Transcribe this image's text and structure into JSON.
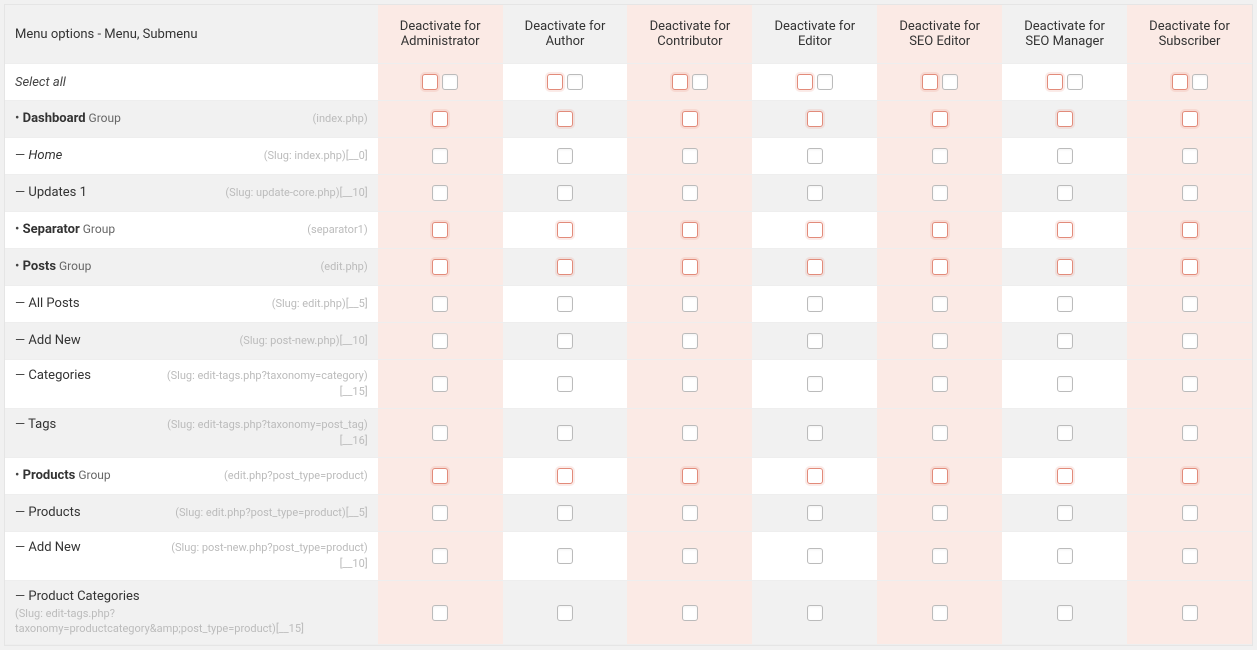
{
  "header": {
    "menu_options": "Menu options - Menu, Submenu"
  },
  "roles": [
    {
      "label": "Deactivate for Administrator",
      "tint": true
    },
    {
      "label": "Deactivate for Author",
      "tint": false
    },
    {
      "label": "Deactivate for Contributor",
      "tint": true
    },
    {
      "label": "Deactivate for Editor",
      "tint": false
    },
    {
      "label": "Deactivate for SEO Editor",
      "tint": true
    },
    {
      "label": "Deactivate for SEO Manager",
      "tint": false
    },
    {
      "label": "Deactivate for Subscriber",
      "tint": true
    }
  ],
  "select_all_label": "Select all",
  "rows": [
    {
      "prefix": "•",
      "label": "Dashboard",
      "suffix": "Group",
      "meta": "(index.php)",
      "bold": true,
      "group": true,
      "alt": true
    },
    {
      "prefix": "—",
      "label": "Home",
      "suffix": "",
      "meta": "(Slug: index.php)[__0]",
      "bold": false,
      "italic": true,
      "group": false,
      "alt": false
    },
    {
      "prefix": "—",
      "label": "Updates 1",
      "suffix": "",
      "meta": "(Slug: update-core.php)[__10]",
      "bold": false,
      "group": false,
      "alt": true
    },
    {
      "prefix": "•",
      "label": "Separator",
      "suffix": "Group",
      "meta": "(separator1)",
      "bold": true,
      "group": true,
      "alt": false
    },
    {
      "prefix": "•",
      "label": "Posts",
      "suffix": "Group",
      "meta": "(edit.php)",
      "bold": true,
      "group": true,
      "alt": true
    },
    {
      "prefix": "—",
      "label": "All Posts",
      "suffix": "",
      "meta": "(Slug: edit.php)[__5]",
      "bold": false,
      "group": false,
      "alt": false
    },
    {
      "prefix": "—",
      "label": "Add New",
      "suffix": "",
      "meta": "(Slug: post-new.php)[__10]",
      "bold": false,
      "group": false,
      "alt": true
    },
    {
      "prefix": "—",
      "label": "Categories",
      "suffix": "",
      "meta": "(Slug: edit-tags.php?taxonomy=category)[__15]",
      "bold": false,
      "group": false,
      "alt": false
    },
    {
      "prefix": "—",
      "label": "Tags",
      "suffix": "",
      "meta": "(Slug: edit-tags.php?taxonomy=post_tag)[__16]",
      "bold": false,
      "group": false,
      "alt": true
    },
    {
      "prefix": "•",
      "label": "Products",
      "suffix": "Group",
      "meta": "(edit.php?post_type=product)",
      "bold": true,
      "group": true,
      "alt": false
    },
    {
      "prefix": "—",
      "label": "Products",
      "suffix": "",
      "meta": "(Slug: edit.php?post_type=product)[__5]",
      "bold": false,
      "group": false,
      "alt": true
    },
    {
      "prefix": "—",
      "label": "Add New",
      "suffix": "",
      "meta": "(Slug: post-new.php?post_type=product)[__10]",
      "bold": false,
      "group": false,
      "alt": false
    },
    {
      "prefix": "—",
      "label": "Product Categories",
      "suffix": "",
      "meta": "(Slug: edit-tags.php?taxonomy=productcategory&amp;post_type=product)[__15]",
      "bold": false,
      "group": false,
      "alt": true,
      "meta_below": true
    }
  ]
}
